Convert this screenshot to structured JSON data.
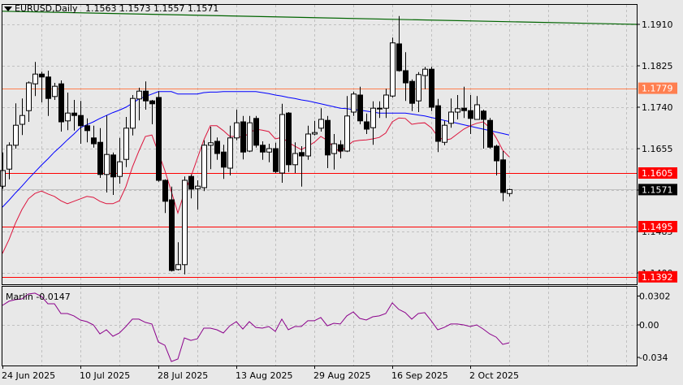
{
  "header": {
    "symbol": "EURUSD,Daily",
    "ohlc": "1.1563 1.1573 1.1557 1.1571"
  },
  "colors": {
    "background": "#e8e8e8",
    "bull_body": "#ffffff",
    "bear_body": "#000000",
    "ma_fast": "#dc143c",
    "ma_slow": "#0000ff",
    "trendline": "#006400",
    "resistance": "#ff7f50",
    "level": "#ff0000",
    "indicator": "#8b008b"
  },
  "chart_data": [
    {
      "type": "candlestick",
      "title": "EURUSD,Daily",
      "y_ticks": [
        "1.1910",
        "1.1825",
        "1.1740",
        "1.1655",
        "1.1570",
        "1.1485",
        "1.1400"
      ],
      "ylim": [
        1.1368,
        1.195
      ],
      "grid": true,
      "date_ticks": [
        {
          "label": "24 Jun 2025",
          "bar": 0
        },
        {
          "label": "10 Jul 2025",
          "bar": 12
        },
        {
          "label": "28 Jul 2025",
          "bar": 24
        },
        {
          "label": "13 Aug 2025",
          "bar": 36
        },
        {
          "label": "29 Aug 2025",
          "bar": 48
        },
        {
          "label": "16 Sep 2025",
          "bar": 60
        },
        {
          "label": "2 Oct 2025",
          "bar": 72
        }
      ],
      "candles": [
        [
          1.1578,
          1.1647,
          1.1573,
          1.161
        ],
        [
          1.1613,
          1.1668,
          1.1592,
          1.1662
        ],
        [
          1.1662,
          1.1748,
          1.1655,
          1.1703
        ],
        [
          1.1705,
          1.1758,
          1.1683,
          1.1723
        ],
        [
          1.1733,
          1.1793,
          1.171,
          1.179
        ],
        [
          1.1788,
          1.1833,
          1.1763,
          1.1808
        ],
        [
          1.1808,
          1.1813,
          1.175,
          1.1802
        ],
        [
          1.1802,
          1.1815,
          1.1722,
          1.1758
        ],
        [
          1.1762,
          1.179,
          1.1755,
          1.1783
        ],
        [
          1.1788,
          1.1795,
          1.169,
          1.171
        ],
        [
          1.1712,
          1.177,
          1.1693,
          1.1728
        ],
        [
          1.1728,
          1.1755,
          1.1692,
          1.1723
        ],
        [
          1.1723,
          1.1753,
          1.1665,
          1.1702
        ],
        [
          1.1702,
          1.1717,
          1.1668,
          1.1692
        ],
        [
          1.1677,
          1.1702,
          1.1657,
          1.1665
        ],
        [
          1.1668,
          1.1697,
          1.1595,
          1.1602
        ],
        [
          1.1602,
          1.1723,
          1.1565,
          1.1643
        ],
        [
          1.1642,
          1.1647,
          1.156,
          1.1597
        ],
        [
          1.1598,
          1.1677,
          1.1583,
          1.1628
        ],
        [
          1.1633,
          1.172,
          1.1617,
          1.1697
        ],
        [
          1.1697,
          1.1765,
          1.1682,
          1.1758
        ],
        [
          1.1757,
          1.178,
          1.1713,
          1.1773
        ],
        [
          1.1773,
          1.1793,
          1.1735,
          1.1753
        ],
        [
          1.1753,
          1.1755,
          1.1705,
          1.1747
        ],
        [
          1.176,
          1.1773,
          1.1587,
          1.159
        ],
        [
          1.159,
          1.1592,
          1.1523,
          1.1547
        ],
        [
          1.155,
          1.1577,
          1.1403,
          1.1405
        ],
        [
          1.1407,
          1.1463,
          1.1405,
          1.1417
        ],
        [
          1.1417,
          1.1598,
          1.1397,
          1.159
        ],
        [
          1.1598,
          1.1602,
          1.1553,
          1.1572
        ],
        [
          1.1573,
          1.159,
          1.153,
          1.1578
        ],
        [
          1.1575,
          1.1672,
          1.1568,
          1.1662
        ],
        [
          1.1662,
          1.17,
          1.1613,
          1.1667
        ],
        [
          1.167,
          1.1678,
          1.1632,
          1.1645
        ],
        [
          1.1648,
          1.1663,
          1.1593,
          1.1617
        ],
        [
          1.1615,
          1.1702,
          1.16,
          1.1677
        ],
        [
          1.1677,
          1.1735,
          1.1672,
          1.1708
        ],
        [
          1.171,
          1.1722,
          1.1633,
          1.1648
        ],
        [
          1.165,
          1.1722,
          1.1648,
          1.1708
        ],
        [
          1.1717,
          1.1722,
          1.1657,
          1.1662
        ],
        [
          1.1662,
          1.167,
          1.1632,
          1.1648
        ],
        [
          1.1648,
          1.1665,
          1.1627,
          1.1655
        ],
        [
          1.1655,
          1.1667,
          1.1605,
          1.1608
        ],
        [
          1.1605,
          1.1747,
          1.1585,
          1.1725
        ],
        [
          1.1728,
          1.173,
          1.1607,
          1.1622
        ],
        [
          1.1622,
          1.1668,
          1.1605,
          1.1645
        ],
        [
          1.1647,
          1.166,
          1.1577,
          1.164
        ],
        [
          1.164,
          1.1702,
          1.1632,
          1.1685
        ],
        [
          1.1685,
          1.1712,
          1.1682,
          1.1688
        ],
        [
          1.1697,
          1.1738,
          1.169,
          1.1715
        ],
        [
          1.1713,
          1.1722,
          1.1615,
          1.1642
        ],
        [
          1.1645,
          1.1685,
          1.1612,
          1.1665
        ],
        [
          1.1663,
          1.1672,
          1.1635,
          1.165
        ],
        [
          1.165,
          1.1763,
          1.1648,
          1.1722
        ],
        [
          1.173,
          1.1772,
          1.1722,
          1.1767
        ],
        [
          1.1765,
          1.1782,
          1.1705,
          1.1712
        ],
        [
          1.171,
          1.1727,
          1.1685,
          1.1695
        ],
        [
          1.1698,
          1.1752,
          1.1663,
          1.1738
        ],
        [
          1.1737,
          1.1752,
          1.1718,
          1.1738
        ],
        [
          1.1738,
          1.1778,
          1.1718,
          1.1765
        ],
        [
          1.1763,
          1.1883,
          1.176,
          1.1872
        ],
        [
          1.187,
          1.1927,
          1.1813,
          1.1815
        ],
        [
          1.1815,
          1.1853,
          1.1753,
          1.179
        ],
        [
          1.1793,
          1.1797,
          1.1732,
          1.1748
        ],
        [
          1.1753,
          1.1812,
          1.173,
          1.1807
        ],
        [
          1.1805,
          1.1823,
          1.1777,
          1.1818
        ],
        [
          1.1818,
          1.1823,
          1.1732,
          1.174
        ],
        [
          1.1743,
          1.1757,
          1.1648,
          1.167
        ],
        [
          1.1668,
          1.1712,
          1.1662,
          1.1703
        ],
        [
          1.1707,
          1.1758,
          1.1698,
          1.173
        ],
        [
          1.173,
          1.1765,
          1.1715,
          1.1737
        ],
        [
          1.1738,
          1.1782,
          1.1718,
          1.1733
        ],
        [
          1.1733,
          1.1765,
          1.1685,
          1.1717
        ],
        [
          1.1715,
          1.1763,
          1.1715,
          1.1745
        ],
        [
          1.1732,
          1.1735,
          1.1655,
          1.1715
        ],
        [
          1.1713,
          1.1718,
          1.1655,
          1.1658
        ],
        [
          1.166,
          1.1663,
          1.16,
          1.163
        ],
        [
          1.1632,
          1.165,
          1.1547,
          1.1565
        ],
        [
          1.1563,
          1.1573,
          1.1557,
          1.1571
        ]
      ],
      "ma_fast": [
        1.144,
        1.1468,
        1.1502,
        1.153,
        1.1552,
        1.1563,
        1.1568,
        1.1562,
        1.1557,
        1.1548,
        1.1542,
        1.1547,
        1.1552,
        1.1557,
        1.1555,
        1.1547,
        1.1542,
        1.1542,
        1.1548,
        1.1577,
        1.1617,
        1.165,
        1.168,
        1.1683,
        1.1647,
        1.161,
        1.1567,
        1.1523,
        1.1565,
        1.1597,
        1.1635,
        1.1673,
        1.1702,
        1.1702,
        1.1692,
        1.168,
        1.168,
        1.1678,
        1.1687,
        1.1695,
        1.1693,
        1.169,
        1.1675,
        1.1678,
        1.1668,
        1.166,
        1.1653,
        1.166,
        1.1668,
        1.168,
        1.1672,
        1.1658,
        1.1648,
        1.166,
        1.167,
        1.1672,
        1.1673,
        1.1675,
        1.1678,
        1.1687,
        1.171,
        1.1718,
        1.1717,
        1.1705,
        1.1707,
        1.1708,
        1.1698,
        1.168,
        1.1672,
        1.1675,
        1.1685,
        1.1695,
        1.1702,
        1.1707,
        1.171,
        1.1698,
        1.1677,
        1.1652,
        1.1638
      ],
      "ma_slow": [
        1.1535,
        1.1549,
        1.1564,
        1.1578,
        1.1593,
        1.1607,
        1.1621,
        1.1634,
        1.1648,
        1.166,
        1.1673,
        1.1685,
        1.1698,
        1.1704,
        1.171,
        1.1717,
        1.1723,
        1.1729,
        1.1734,
        1.174,
        1.1748,
        1.1757,
        1.1762,
        1.1767,
        1.1772,
        1.1772,
        1.1772,
        1.1767,
        1.1767,
        1.1767,
        1.1767,
        1.177,
        1.1771,
        1.1771,
        1.1772,
        1.1772,
        1.1772,
        1.1772,
        1.1772,
        1.1772,
        1.177,
        1.1768,
        1.1765,
        1.1763,
        1.176,
        1.1758,
        1.1755,
        1.1753,
        1.175,
        1.1747,
        1.1744,
        1.1741,
        1.1738,
        1.1737,
        1.1735,
        1.1734,
        1.1732,
        1.173,
        1.1728,
        1.1728,
        1.1728,
        1.1728,
        1.1728,
        1.1726,
        1.1724,
        1.1722,
        1.1719,
        1.1716,
        1.1713,
        1.171,
        1.1707,
        1.1704,
        1.1701,
        1.1698,
        1.1695,
        1.1692,
        1.1689,
        1.1686,
        1.1683
      ],
      "trendline": {
        "start": 1.1937,
        "end": 1.191
      },
      "levels": [
        {
          "label": "1.1779",
          "value": 1.1779,
          "color": "#ff7f50",
          "text_color": "#ffffff"
        },
        {
          "label": "1.1605",
          "value": 1.1605,
          "color": "#ff0000",
          "text_color": "#ffffff"
        },
        {
          "label": "1.1495",
          "value": 1.1495,
          "color": "#ff0000",
          "text_color": "#ffffff"
        },
        {
          "label": "1.1392",
          "value": 1.1392,
          "color": "#ff0000",
          "text_color": "#ffffff"
        }
      ],
      "current_price": {
        "label": "1.1571",
        "value": 1.1571
      }
    },
    {
      "type": "line",
      "title": "Marlin -0.0147",
      "series_name": "Marlin",
      "last_value": "-0.0147",
      "y_ticks": [
        "0.0302",
        "0.00",
        "-0.034"
      ],
      "ylim": [
        -0.0425,
        0.0395
      ],
      "values": [
        0.0204,
        0.0247,
        0.0264,
        0.0272,
        0.0323,
        0.0332,
        0.0298,
        0.0221,
        0.0221,
        0.0119,
        0.0119,
        0.0094,
        0.0051,
        0.0034,
        0.0,
        -0.0094,
        -0.0051,
        -0.0119,
        -0.0085,
        -0.0017,
        0.006,
        0.006,
        0.0026,
        0.0009,
        -0.0179,
        -0.0213,
        -0.0383,
        -0.0357,
        -0.0136,
        -0.0162,
        -0.0145,
        -0.0034,
        -0.0034,
        -0.0051,
        -0.0085,
        -0.0009,
        0.0034,
        -0.0043,
        0.0034,
        -0.0026,
        -0.0034,
        -0.0017,
        -0.0068,
        0.006,
        -0.0051,
        -0.0017,
        -0.0017,
        0.0043,
        0.0043,
        0.0077,
        -0.0009,
        0.0017,
        0.0009,
        0.0094,
        0.0136,
        0.0068,
        0.0051,
        0.0085,
        0.0094,
        0.0119,
        0.023,
        0.0162,
        0.0128,
        0.006,
        0.0119,
        0.0128,
        0.0043,
        -0.0051,
        -0.0026,
        0.0009,
        0.0009,
        0.0,
        -0.0017,
        0.0,
        -0.0043,
        -0.0094,
        -0.0128,
        -0.0204,
        -0.0187
      ]
    }
  ]
}
